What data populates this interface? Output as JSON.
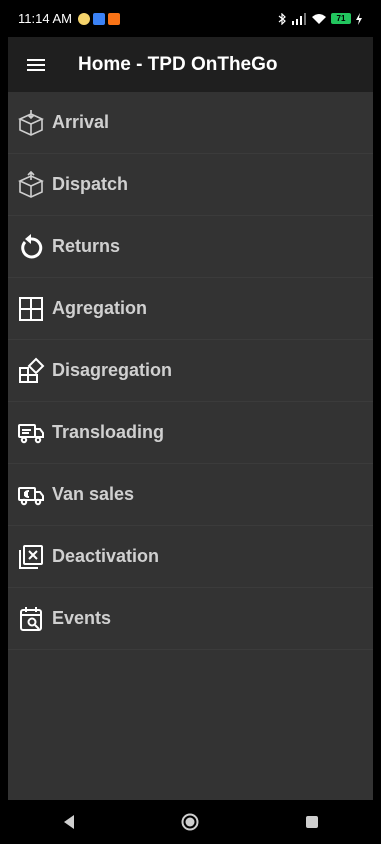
{
  "status_bar": {
    "time": "11:14 AM",
    "battery": "71",
    "icons": [
      "alarm-icon",
      "notification-icon",
      "app-icon",
      "bluetooth-icon",
      "signal-icon",
      "wifi-icon",
      "battery-icon",
      "charging-icon"
    ]
  },
  "app_bar": {
    "title": "Home - TPD OnTheGo"
  },
  "menu": {
    "items": [
      {
        "label": "Arrival",
        "icon": "box-arrival-icon"
      },
      {
        "label": "Dispatch",
        "icon": "box-dispatch-icon"
      },
      {
        "label": "Returns",
        "icon": "return-icon"
      },
      {
        "label": "Agregation",
        "icon": "grid-icon"
      },
      {
        "label": "Disagregation",
        "icon": "grid-split-icon"
      },
      {
        "label": "Transloading",
        "icon": "truck-transfer-icon"
      },
      {
        "label": "Van sales",
        "icon": "van-sales-icon"
      },
      {
        "label": "Deactivation",
        "icon": "deactivate-icon"
      },
      {
        "label": "Events",
        "icon": "calendar-search-icon"
      }
    ]
  },
  "nav_bar": {
    "buttons": [
      "back-icon",
      "home-icon",
      "recents-icon"
    ]
  },
  "colors": {
    "screen_bg": "#333333",
    "appbar_bg": "#1f1f1f",
    "text": "#d0d0d0",
    "battery": "#22c55e"
  }
}
